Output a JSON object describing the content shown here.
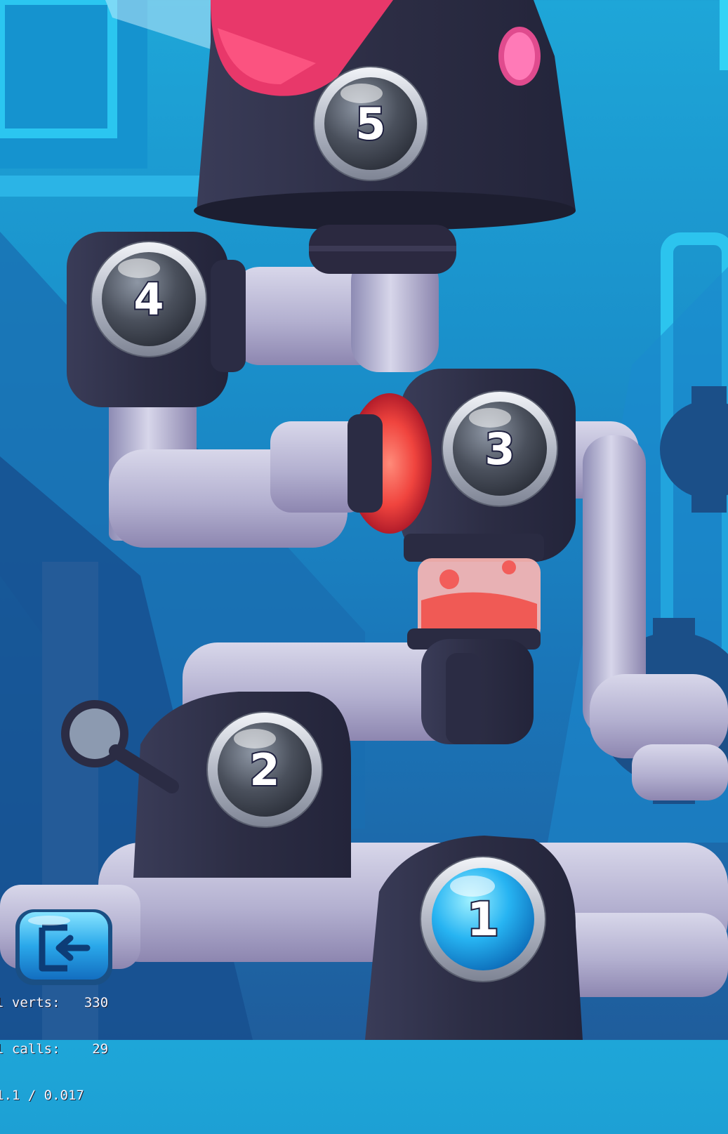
{
  "levels": [
    {
      "number": "1",
      "state": "unlocked",
      "color": "#27b4f2"
    },
    {
      "number": "2",
      "state": "locked",
      "color": "#4d535f"
    },
    {
      "number": "3",
      "state": "locked",
      "color": "#4d535f"
    },
    {
      "number": "4",
      "state": "locked",
      "color": "#4d535f"
    },
    {
      "number": "5",
      "state": "locked",
      "color": "#4d535f"
    }
  ],
  "exit_button": {
    "icon": "exit-door-icon",
    "color": "#2aa8ea"
  },
  "debug": {
    "verts": "l verts:   330",
    "calls": "l calls:    29",
    "timing": "1.1 / 0.017"
  },
  "colors": {
    "background": "#1a8fca",
    "pipe": "#b7b5d4",
    "machine": "#2c2d44",
    "glow_red": "#f0443e",
    "glow_pink": "#e04b8e"
  }
}
